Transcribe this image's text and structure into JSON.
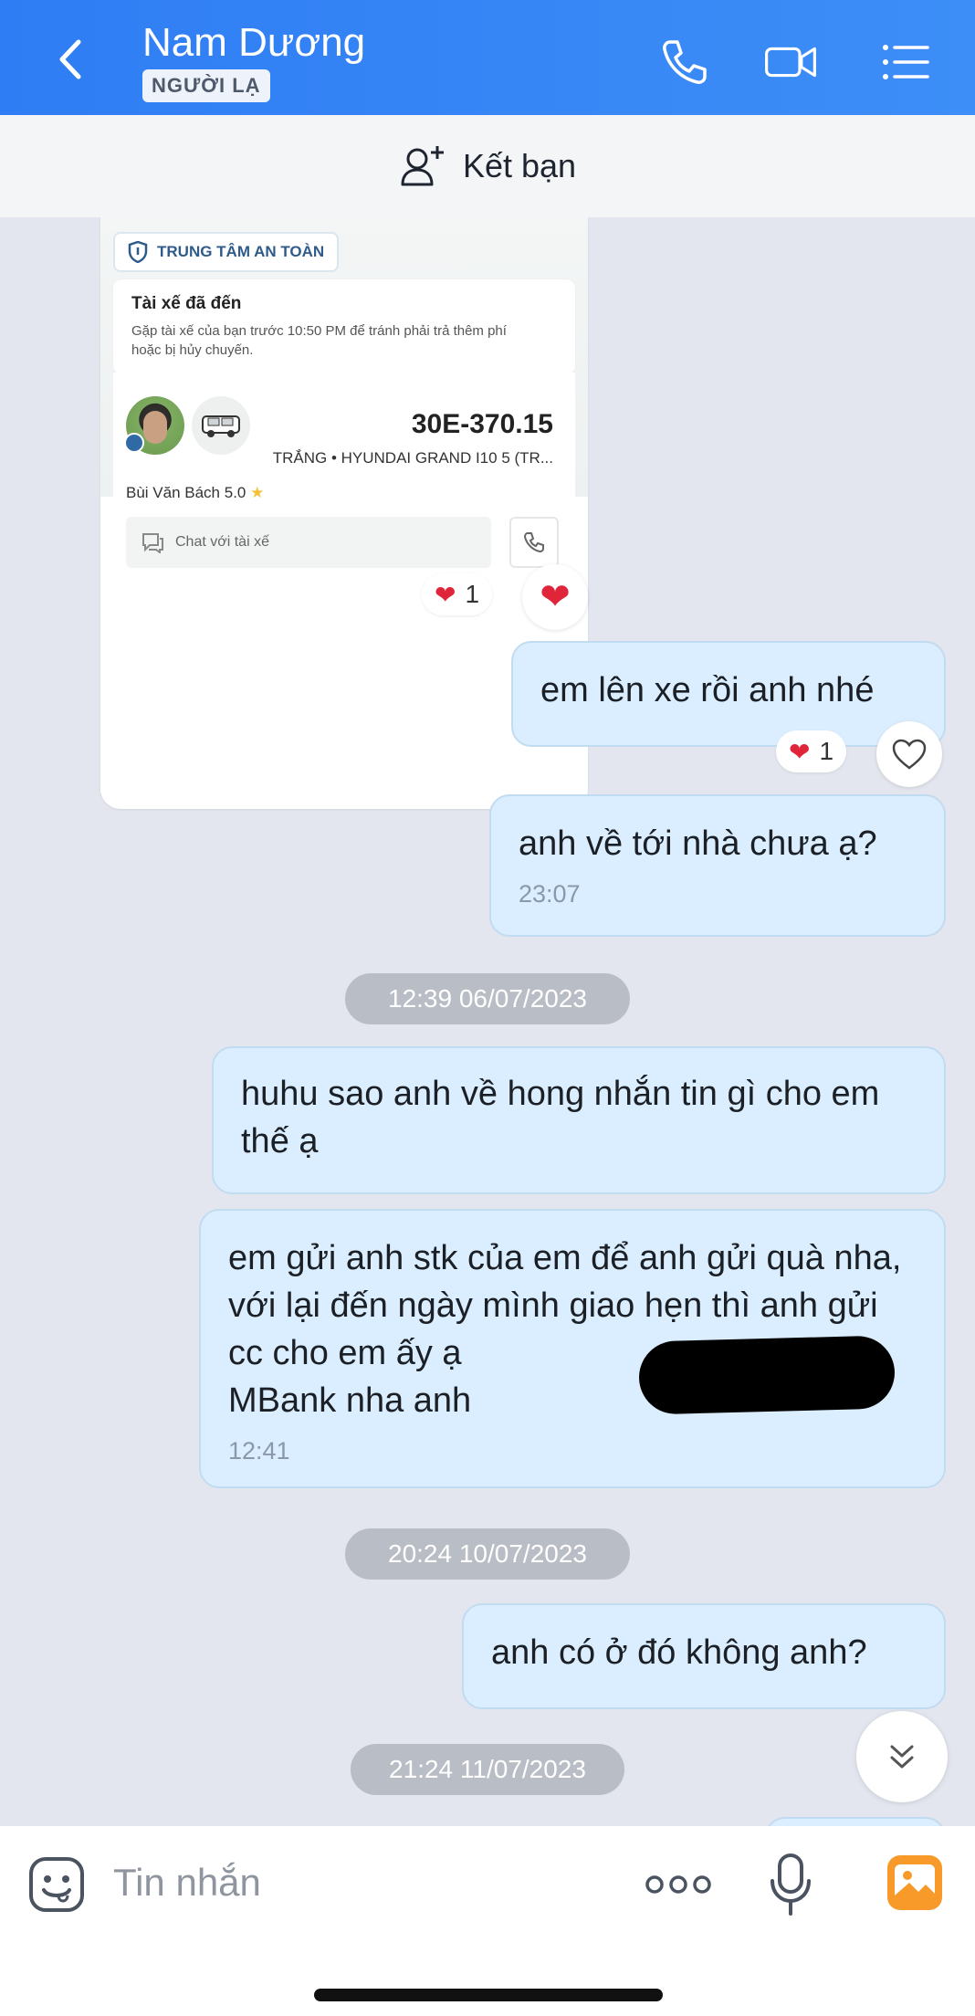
{
  "header": {
    "title": "Nam Dương",
    "badge": "NGƯỜI LẠ",
    "accent": "#2f7df4"
  },
  "friend_bar": {
    "label": "Kết bạn"
  },
  "shared_image": {
    "safety_label": "TRUNG TÂM AN TOÀN",
    "arrived_title": "Tài xế đã đến",
    "arrived_text_1": "Gặp tài xế của bạn trước 10:50 PM để tránh phải trả thêm phí",
    "arrived_text_2": "hoặc bị hủy chuyến.",
    "plate": "30E-370.15",
    "car_info": "TRẮNG • HYUNDAI GRAND I10 5 (TR...",
    "driver_name": "Bùi Văn Bách",
    "driver_rating": "5.0",
    "chat_driver": "Chat với tài xế",
    "reaction_count": "1"
  },
  "messages": [
    {
      "text": "em lên xe rồi anh nhé",
      "reaction_count": "1"
    },
    {
      "text": "anh về tới nhà chưa ạ?",
      "time": "23:07"
    },
    {
      "date": "12:39 06/07/2023"
    },
    {
      "text": "huhu sao anh về hong nhắn tin gì cho em thế ạ"
    },
    {
      "text_1": "em gửi anh stk của em để anh gửi quà nha, với lại đến ngày mình giao hẹn thì anh gửi cc cho em ấy ạ",
      "text_2": "MBank nha anh",
      "time": "12:41"
    },
    {
      "date": "20:24 10/07/2023"
    },
    {
      "text": "anh có ở đó không anh?"
    },
    {
      "date": "21:24 11/07/2023"
    }
  ],
  "input": {
    "placeholder": "Tin nhắn"
  }
}
